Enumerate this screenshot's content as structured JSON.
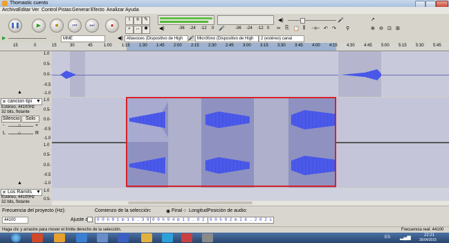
{
  "window": {
    "title": "Thomastic cuento"
  },
  "menu": [
    "Archivo",
    "Editar",
    "Ver",
    "Control",
    "Pistas",
    "Generar",
    "Efecto",
    "Analizar",
    "Ayuda"
  ],
  "transport": {
    "pause": "pause-icon",
    "play": "play-icon",
    "stop": "stop-icon",
    "skip_start": "skip-start-icon",
    "skip_end": "skip-end-icon",
    "record": "record-icon"
  },
  "meters": {
    "output": {
      "label": "L\nR",
      "scale": [
        "-36",
        "-24",
        "-12",
        "0"
      ]
    },
    "input": {
      "scale": [
        "-36",
        "-24",
        "-12",
        "0"
      ]
    }
  },
  "device_toolbar": {
    "host": "MME",
    "output_device": "Altavoces (Dispositivo de High",
    "input_device": "Micrófono (Dispositivo de High",
    "channels": "2 (estéreo) canal"
  },
  "ruler": {
    "ticks": [
      "15",
      "0",
      "15",
      "30",
      "45",
      "1:00",
      "1:15",
      "1:30",
      "1:45",
      "2:00",
      "2:15",
      "2:30",
      "2:45",
      "3:00",
      "3:15",
      "3:30",
      "3:45",
      "4:00",
      "4:15",
      "4:30",
      "4:45",
      "5:00",
      "5:15",
      "5:30",
      "5:45"
    ]
  },
  "scale_labels": [
    "1.0",
    "0.5-",
    "0.0-",
    "-0.5",
    "-1.0"
  ],
  "tracks": [
    {
      "name": "",
      "info": []
    },
    {
      "name": "cancion tipi",
      "info": [
        "Estéreo, 44100Hz",
        "32 bits, flotante"
      ],
      "mute": "Silencio",
      "solo": "Solo",
      "gain_left": "-",
      "gain_right": "+",
      "pan_left": "L",
      "pan_right": "R"
    },
    {
      "name": "Los Ramits",
      "info": [
        "Estéreo, 44100Hz",
        "32 bits, flotante"
      ]
    }
  ],
  "bottom": {
    "project_rate_label": "Frecuencia del proyecto (Hz):",
    "project_rate_value": "44100",
    "snap_label": "Ajuste a",
    "selection_start_label": "Comienzo de la selección:",
    "end_option": "Final",
    "length_option": "Longitud",
    "selection_start": "0 0 h 0 1 m 1 6 . 3 9 9 s",
    "selection_end": "0 0 h 0 4 m 1 3 . 0 2 4 s",
    "audio_position_label": "Posición de audio:",
    "audio_position": "0 0 h 0 2 m 2 6 . 2 0 2 s"
  },
  "status": {
    "message": "Haga clic y arrastre para mover el límite derecho de la selección.",
    "rate": "Frecuencia real: 44100"
  },
  "taskbar": {
    "lang": "ES",
    "time": "22:21",
    "date": "26/04/2015"
  }
}
